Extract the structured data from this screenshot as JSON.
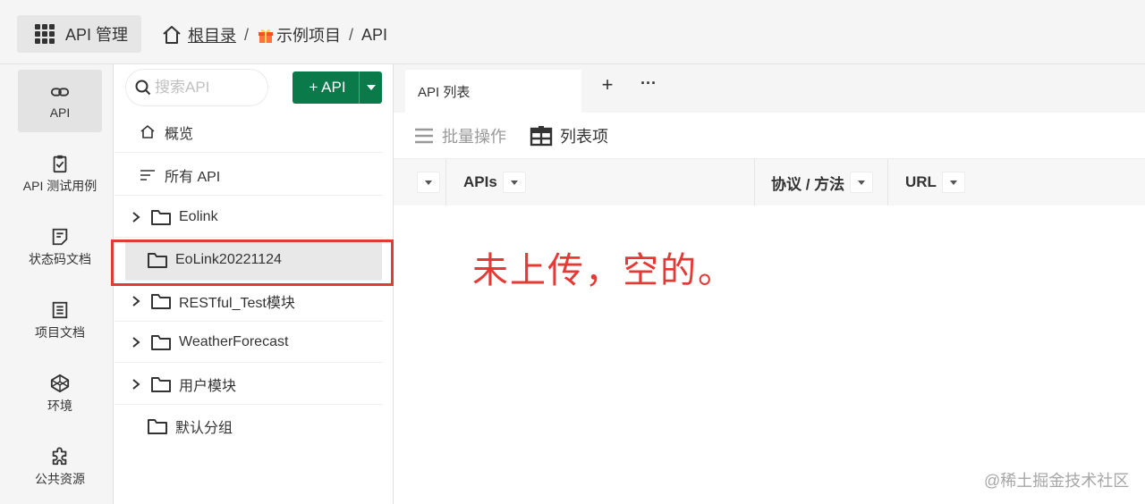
{
  "topbar": {
    "app_label": "API 管理",
    "breadcrumb": {
      "root": "根目录",
      "separator": "/",
      "project": "示例项目",
      "current": "API"
    }
  },
  "leftnav": {
    "items": [
      {
        "label": "API",
        "icon": "link-icon"
      },
      {
        "label": "API 测试用例",
        "icon": "clipboard-check-icon"
      },
      {
        "label": "状态码文档",
        "icon": "note-icon"
      },
      {
        "label": "项目文档",
        "icon": "document-icon"
      },
      {
        "label": "环境",
        "icon": "codepen-icon"
      },
      {
        "label": "公共资源",
        "icon": "puzzle-icon"
      }
    ]
  },
  "tree": {
    "search_placeholder": "搜索API",
    "add_button": "+ API",
    "items": [
      {
        "label": "概览"
      },
      {
        "label": "所有 API"
      },
      {
        "label": "Eolink"
      },
      {
        "label": "EoLink20221124"
      },
      {
        "label": "RESTful_Test模块"
      },
      {
        "label": "WeatherForecast"
      },
      {
        "label": "用户模块"
      },
      {
        "label": "默认分组"
      }
    ]
  },
  "tabs": {
    "active": "API 列表",
    "plus": "+",
    "more": "···"
  },
  "toolbar": {
    "batch": "批量操作",
    "columns": "列表项"
  },
  "table": {
    "headers": [
      "APIs",
      "协议 / 方法",
      "URL"
    ]
  },
  "annotation": "未上传，空的。",
  "watermark": "@稀土掘金技术社区",
  "colors": {
    "accent_green": "#0b7a4a",
    "highlight_red": "#e53935"
  }
}
